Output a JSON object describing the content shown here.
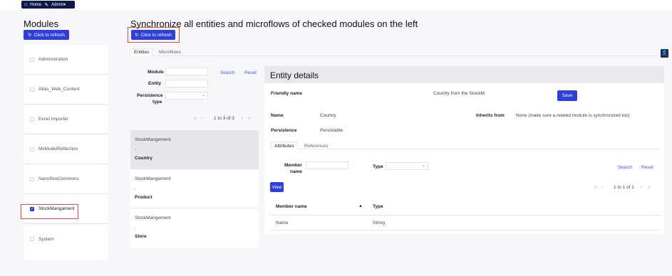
{
  "nav": {
    "home": "Home",
    "admin": "Admin▾"
  },
  "modules": {
    "title": "Modules",
    "refresh": "Click to refresh",
    "items": [
      {
        "label": "Administration",
        "checked": false
      },
      {
        "label": "Atlas_Web_Content",
        "checked": false
      },
      {
        "label": "Excel Importer",
        "checked": false
      },
      {
        "label": "MxModelReflection",
        "checked": false
      },
      {
        "label": "NanoflowCommons",
        "checked": false
      },
      {
        "label": "StockMangament",
        "checked": true
      },
      {
        "label": "System",
        "checked": false
      }
    ]
  },
  "main": {
    "title": "Synchronize all entities and microflows of checked modules on the left",
    "refresh": "Click to refresh",
    "tabs": [
      "Entities",
      "Microflows"
    ]
  },
  "search": {
    "module_label": "Module",
    "entity_label": "Entity",
    "persistence_label_1": "Persistence",
    "persistence_label_2": "type",
    "search": "Search",
    "reset": "Reset",
    "pager": "1 to 3 of 3"
  },
  "entities": [
    {
      "module": "StockMangement",
      "dot": ".",
      "name": "Country"
    },
    {
      "module": "StockMangement",
      "dot": ".",
      "name": "Product"
    },
    {
      "module": "StockMangement",
      "dot": ".",
      "name": "Store"
    }
  ],
  "details": {
    "title": "Entity details",
    "friendly_label": "Friendly name",
    "friendly_value": "Country from the StockM.",
    "save": "Save",
    "name_label": "Name",
    "name_value": "Country",
    "inherits_label": "Inherits from",
    "inherits_value": "None (make sure a related module is synchronized too)",
    "persistence_label": "Persistence",
    "persistence_value": "Persistable",
    "tabs": [
      "Attributes",
      "References"
    ],
    "member_label_1": "Member",
    "member_label_2": "name",
    "type_label": "Type",
    "search": "Search",
    "reset": "Reset",
    "view": "View",
    "pager": "1 to 1 of 1",
    "col_member": "Member name",
    "col_type": "Type",
    "sort_icon": "▲",
    "rows": [
      {
        "member": "Name",
        "type": "String"
      }
    ]
  },
  "colors": {
    "accent": "#2f3fd9",
    "navbar": "#0b1a4a",
    "highlight": "#e34a4a"
  }
}
